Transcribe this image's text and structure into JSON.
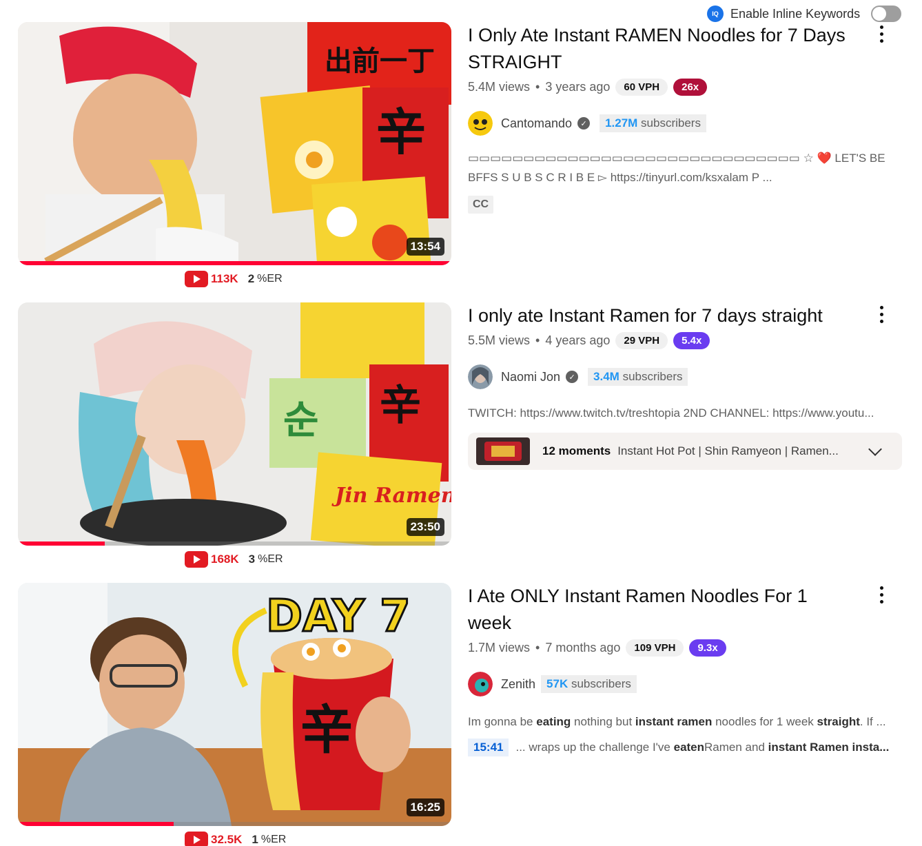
{
  "toolbar": {
    "iq_badge": "IQ",
    "inline_keywords_label": "Enable Inline Keywords",
    "inline_keywords_enabled": false
  },
  "videos": [
    {
      "title": "I Only Ate Instant RAMEN Noodles for 7 Days STRAIGHT",
      "views": "5.4M views",
      "age": "3 years ago",
      "vph": "60 VPH",
      "multiplier": "26x",
      "multiplier_color": "#b0103a",
      "channel": "Cantomando",
      "subs_count": "1.27M",
      "subs_label": " subscribers",
      "description": "▭▭▭▭▭▭▭▭▭▭▭▭▭▭▭▭▭▭▭▭▭▭▭▭▭▭▭▭▭▭ ☆ ❤️ LET'S BE BFFS S U B S C R I B E ▻ https://tinyurl.com/ksxalam P ...",
      "cc": "CC",
      "duration": "13:54",
      "watched_fraction": 1.0,
      "likes": "113K",
      "er_value": "2",
      "er_label": "%ER",
      "thumb_text": "出前一丁"
    },
    {
      "title": "I only ate Instant Ramen for 7 days straight",
      "views": "5.5M views",
      "age": "4 years ago",
      "vph": "29 VPH",
      "multiplier": "5.4x",
      "multiplier_color": "#6a3cf0",
      "channel": "Naomi Jon",
      "subs_count": "3.4M",
      "subs_label": " subscribers",
      "description": "TWITCH: https://www.twitch.tv/treshtopia 2ND CHANNEL: https://www.youtu...",
      "moments_count": "12 moments",
      "moments_text": "Instant Hot Pot | Shin Ramyeon | Ramen...",
      "duration": "23:50",
      "watched_fraction": 0.2,
      "likes": "168K",
      "er_value": "3",
      "er_label": "%ER",
      "thumb_text": "Jin Ramen"
    },
    {
      "title": "I Ate ONLY Instant Ramen Noodles For 1 week",
      "views": "1.7M views",
      "age": "7 months ago",
      "vph": "109 VPH",
      "multiplier": "9.3x",
      "multiplier_color": "#6a3cf0",
      "channel": "Zenith",
      "subs_count": "57K",
      "subs_label": " subscribers",
      "desc_parts": [
        "Im gonna be ",
        "eating",
        " nothing but ",
        "instant ramen",
        " noodles for 1 week ",
        "straight",
        ". If ..."
      ],
      "chapter_ts": "15:41",
      "chapter_parts": [
        "... wraps up the challenge I've ",
        "eaten",
        " Ramen and ",
        "instant Ramen insta..."
      ],
      "duration": "16:25",
      "watched_fraction": 0.36,
      "likes": "32.5K",
      "er_value": "1",
      "er_label": "%ER",
      "thumb_text": "DAY 7"
    }
  ]
}
